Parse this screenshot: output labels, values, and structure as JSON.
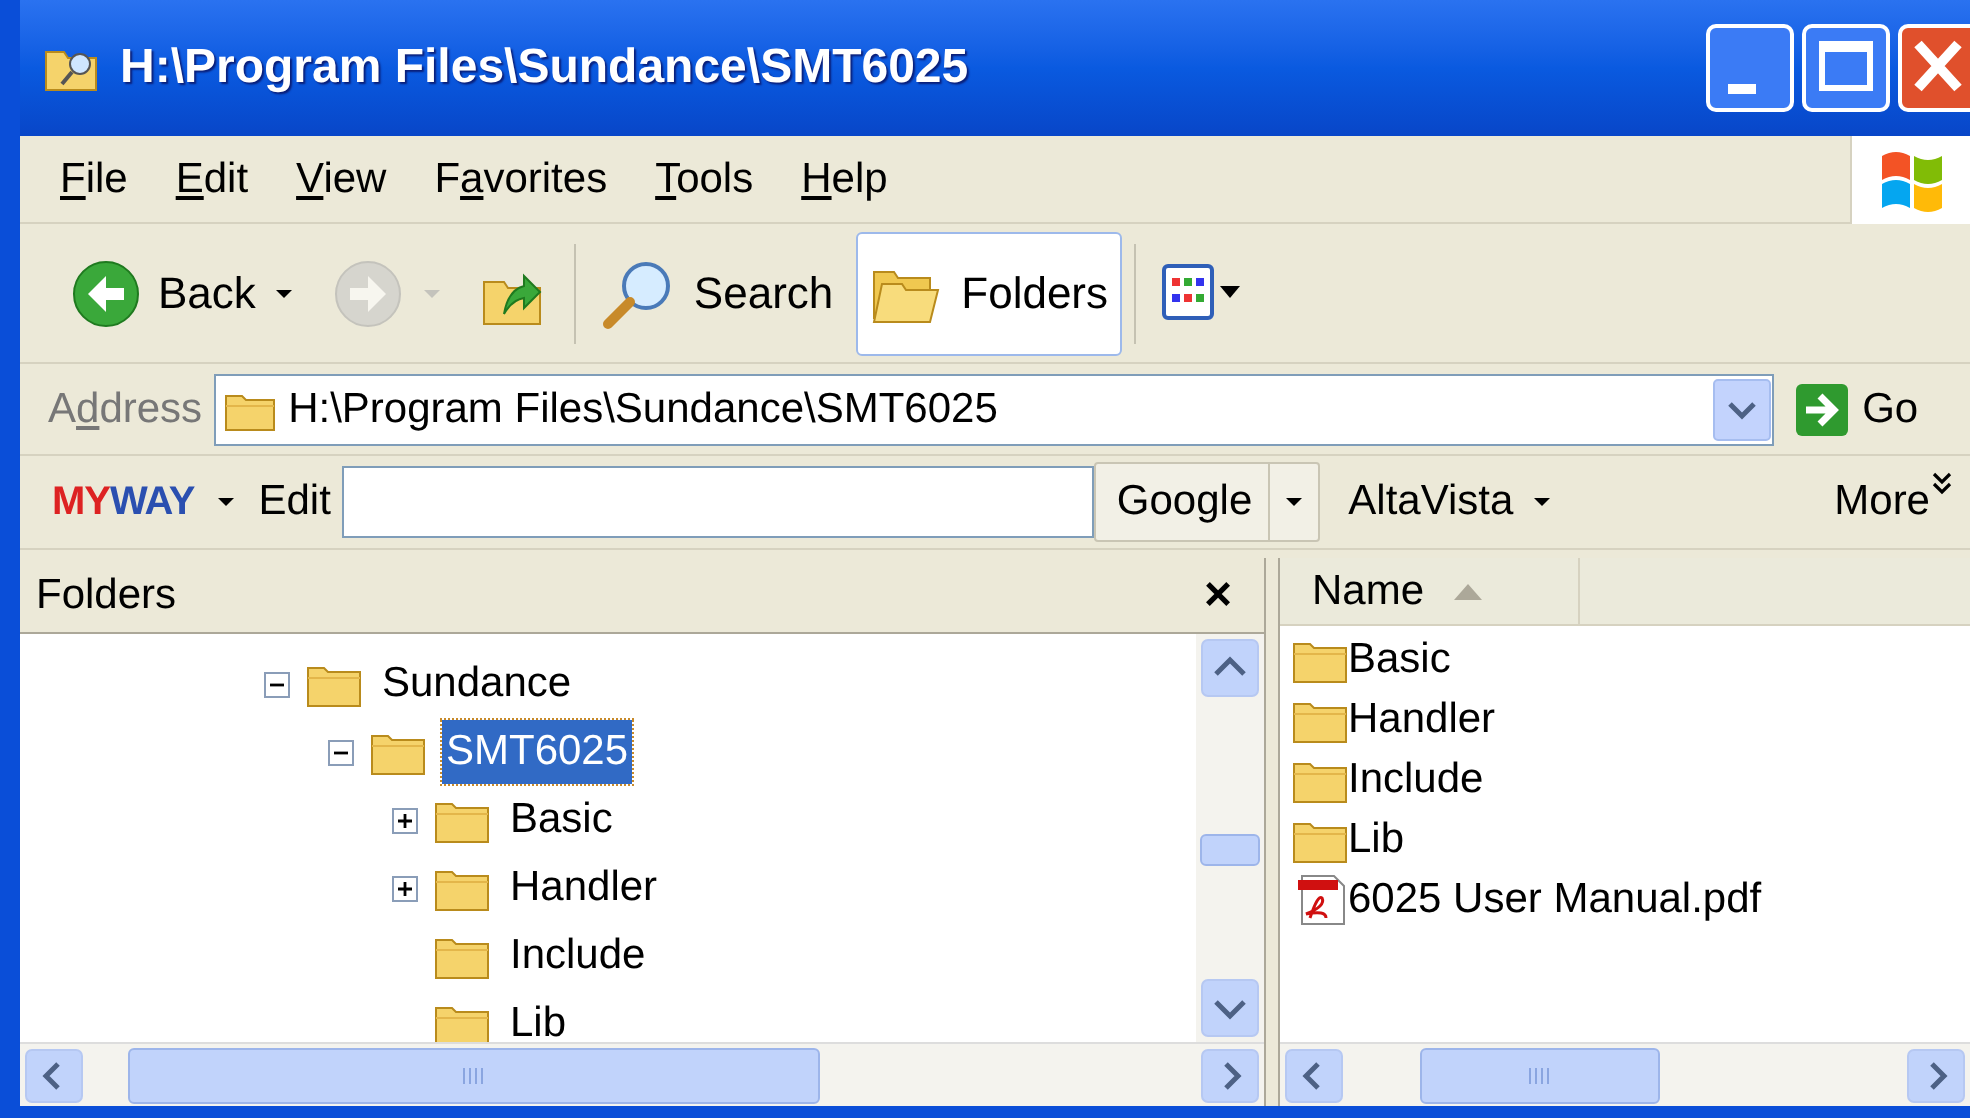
{
  "window": {
    "title": "H:\\Program Files\\Sundance\\SMT6025"
  },
  "menu": [
    {
      "key": "F",
      "rest": "ile"
    },
    {
      "key": "E",
      "rest": "dit"
    },
    {
      "key": "V",
      "rest": "iew"
    },
    {
      "pre": "F",
      "key": "a",
      "rest": "vorites"
    },
    {
      "key": "T",
      "rest": "ools"
    },
    {
      "key": "H",
      "rest": "elp"
    }
  ],
  "toolbar": [
    {
      "kind": "back",
      "label": "Back",
      "disabled": false,
      "selected": false
    },
    {
      "kind": "forward",
      "disabled": true,
      "selected": false
    },
    {
      "kind": "up",
      "disabled": false,
      "selected": false
    },
    {
      "kind": "search",
      "label": "Search",
      "disabled": false,
      "selected": false
    },
    {
      "kind": "folders",
      "label": "Folders",
      "disabled": false,
      "selected": true
    },
    {
      "kind": "views",
      "disabled": false,
      "selected": false
    }
  ],
  "address": {
    "label_parts": [
      "A",
      "d",
      "dress"
    ],
    "value": "H:\\Program Files\\Sundance\\SMT6025",
    "go": "Go"
  },
  "myway": {
    "logo_parts": [
      "MY",
      "WAY"
    ],
    "edit": "Edit",
    "engines": [
      "Google",
      "AltaVista"
    ],
    "more": "More"
  },
  "folders_pane": {
    "title": "Folders",
    "close": "×",
    "tree": [
      {
        "label": "Sundance",
        "kind": "branch",
        "expanded": true,
        "selected": false,
        "children": [
          {
            "label": "SMT6025",
            "kind": "branch",
            "expanded": true,
            "selected": true,
            "children": [
              {
                "label": "Basic",
                "kind": "branch",
                "expanded": false,
                "selected": false
              },
              {
                "label": "Handler",
                "kind": "branch",
                "expanded": false,
                "selected": false
              },
              {
                "label": "Include",
                "kind": "leaf",
                "selected": false
              },
              {
                "label": "Lib",
                "kind": "leaf",
                "selected": false
              }
            ]
          }
        ]
      }
    ]
  },
  "file_list": {
    "columns": [
      "Name"
    ],
    "items": [
      {
        "name": "Basic",
        "kind": "folder"
      },
      {
        "name": "Handler",
        "kind": "folder"
      },
      {
        "name": "Include",
        "kind": "folder"
      },
      {
        "name": "Lib",
        "kind": "folder"
      },
      {
        "name": "6025 User Manual.pdf",
        "kind": "pdf"
      }
    ]
  }
}
